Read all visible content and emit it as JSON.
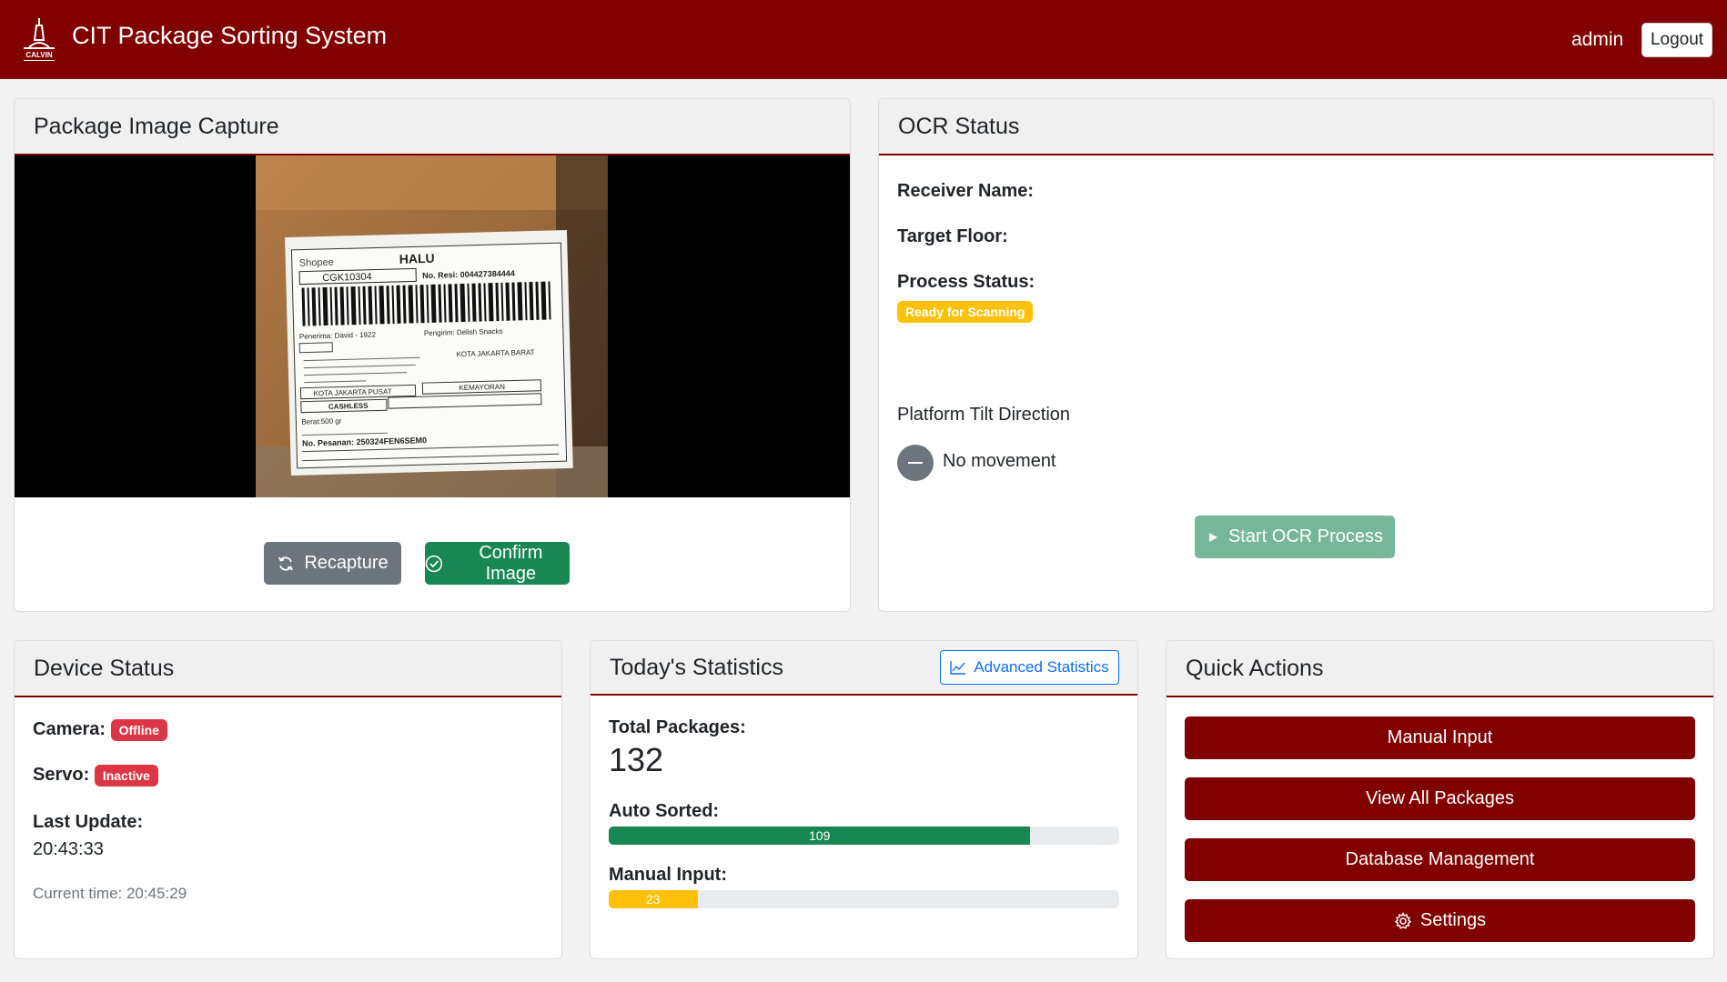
{
  "navbar": {
    "brand": "CIT Package Sorting System",
    "logo_text": "CALVIN",
    "user": "admin",
    "logout_label": "Logout"
  },
  "capture": {
    "title": "Package Image Capture",
    "recapture_label": "Recapture",
    "confirm_label": "Confirm Image",
    "label_text": {
      "shop": "Shopee",
      "code": "HALU",
      "route": "CGK10304",
      "resi": "No. Resi: 004427384444",
      "receiver": "Penerima: David - 1922",
      "sender": "Pengirim: Delish Snacks",
      "city_from": "KOTA JAKARTA BARAT",
      "city_to": "KOTA JAKARTA PUSAT",
      "district": "KEMAYORAN",
      "payment": "CASHLESS",
      "weight": "Berat:500 gr",
      "order": "No. Pesanan: 250324FEN6SEM0"
    }
  },
  "ocr": {
    "title": "OCR Status",
    "receiver_label": "Receiver Name:",
    "floor_label": "Target Floor:",
    "process_label": "Process Status:",
    "process_badge": "Ready for Scanning",
    "tilt_title": "Platform Tilt Direction",
    "tilt_value": "No movement",
    "start_label": "Start OCR Process"
  },
  "device": {
    "title": "Device Status",
    "camera_label": "Camera:",
    "camera_status": "Offline",
    "servo_label": "Servo:",
    "servo_status": "Inactive",
    "last_update_label": "Last Update:",
    "last_update_value": "20:43:33",
    "current_time": "Current time: 20:45:29"
  },
  "stats": {
    "title": "Today's Statistics",
    "advanced_label": "Advanced Statistics",
    "total_label": "Total Packages:",
    "total_value": "132",
    "auto_label": "Auto Sorted:",
    "auto_value": "109",
    "auto_fraction": 0.826,
    "manual_label": "Manual Input:",
    "manual_value": "23",
    "manual_fraction": 0.174
  },
  "actions": {
    "title": "Quick Actions",
    "manual_input": "Manual Input",
    "view_all": "View All Packages",
    "database": "Database Management",
    "settings": "Settings"
  },
  "colors": {
    "brand": "#800000",
    "success": "#198754",
    "warning": "#ffc107",
    "danger": "#dc3545",
    "secondary": "#6c757d",
    "primary": "#0d6efd"
  }
}
